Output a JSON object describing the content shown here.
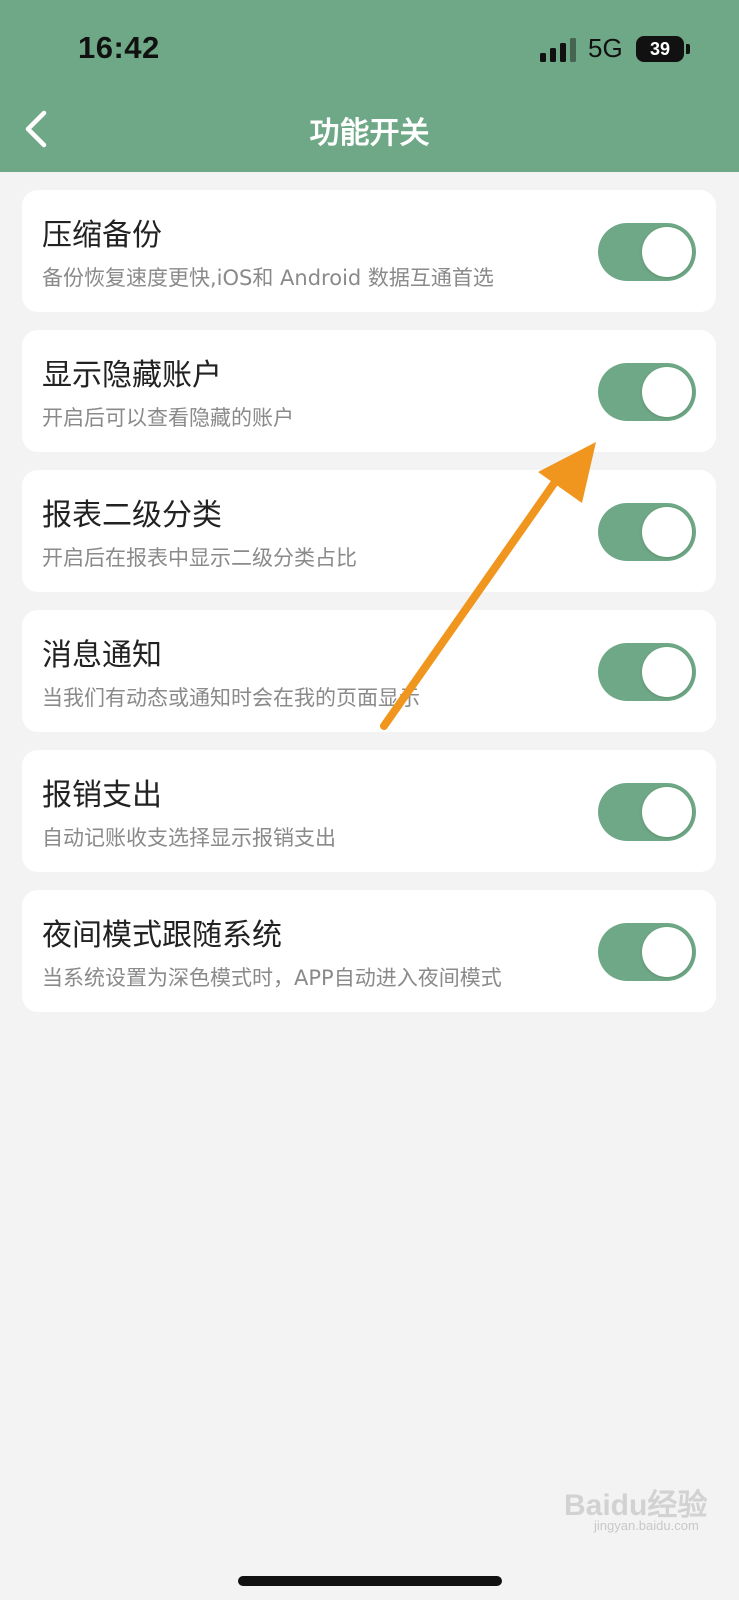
{
  "status_bar": {
    "time": "16:42",
    "network": "5G",
    "battery": "39"
  },
  "header": {
    "title": "功能开关",
    "back_icon": "chevron-left-icon"
  },
  "colors": {
    "header_bg": "#6fa886",
    "toggle_on": "#6fa886",
    "page_bg": "#f3f3f3",
    "annotation_arrow": "#f0961e"
  },
  "settings": [
    {
      "title": "压缩备份",
      "desc": "备份恢复速度更快,iOS和 Android 数据互通首选",
      "enabled": true
    },
    {
      "title": "显示隐藏账户",
      "desc": "开启后可以查看隐藏的账户",
      "enabled": true
    },
    {
      "title": "报表二级分类",
      "desc": "开启后在报表中显示二级分类占比",
      "enabled": true
    },
    {
      "title": "消息通知",
      "desc": "当我们有动态或通知时会在我的页面显示",
      "enabled": true
    },
    {
      "title": "报销支出",
      "desc": "自动记账收支选择显示报销支出",
      "enabled": true
    },
    {
      "title": "夜间模式跟随系统",
      "desc": "当系统设置为深色模式时，APP自动进入夜间模式",
      "enabled": true
    }
  ],
  "watermark": {
    "text": "Baidu经验",
    "sub": "jingyan.baidu.com"
  }
}
